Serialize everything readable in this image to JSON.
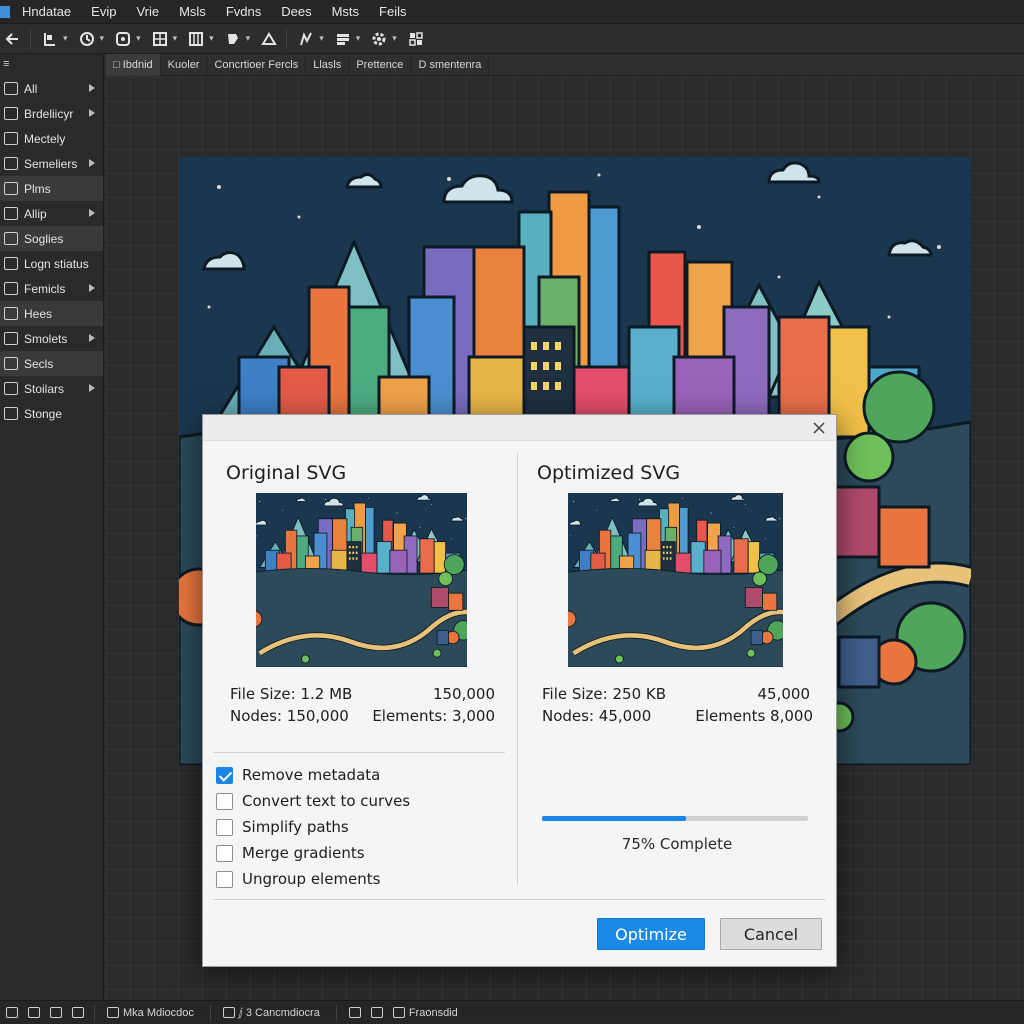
{
  "app": {
    "menu": [
      "Hndatae",
      "Evip",
      "Vrie",
      "Msls",
      "Fvdns",
      "Dees",
      "Msts",
      "Feils"
    ]
  },
  "toolbar": {
    "icons": [
      "back-icon",
      "select-tool-icon",
      "rotate-icon",
      "node-tool-icon",
      "grid-icon",
      "columns-icon",
      "bucket-icon",
      "crop-icon",
      "pen-icon",
      "layers-icon",
      "settings-icon",
      "component-icon"
    ]
  },
  "left_panel": {
    "header": "≡",
    "items": [
      {
        "label": "All",
        "icon": "grid-icon",
        "has_arrow": true,
        "highlight": false
      },
      {
        "label": "Brdeliicyr",
        "icon": "layers-icon",
        "has_arrow": true,
        "highlight": false
      },
      {
        "label": "Mectely",
        "icon": "image-icon",
        "has_arrow": false,
        "highlight": false
      },
      {
        "label": "Semeliers",
        "icon": "shapes-icon",
        "has_arrow": true,
        "highlight": false
      },
      {
        "label": "Plms",
        "icon": "brush-icon",
        "has_arrow": false,
        "highlight": true
      },
      {
        "label": "Allip",
        "icon": "clip-icon",
        "has_arrow": true,
        "highlight": false
      },
      {
        "label": "Soglies",
        "icon": "link-icon",
        "has_arrow": false,
        "highlight": true
      },
      {
        "label": "Logn stiatus",
        "icon": "login-icon",
        "has_arrow": false,
        "highlight": false
      },
      {
        "label": "Femicls",
        "icon": "folder-icon",
        "has_arrow": true,
        "highlight": false
      },
      {
        "label": "Hees",
        "icon": "grid-icon",
        "has_arrow": false,
        "highlight": true
      },
      {
        "label": "Smolets",
        "icon": "diamond-icon",
        "has_arrow": true,
        "highlight": false
      },
      {
        "label": "Secls",
        "icon": "palette-icon",
        "has_arrow": false,
        "highlight": true
      },
      {
        "label": "Stoilars",
        "icon": "sliders-icon",
        "has_arrow": true,
        "highlight": false
      },
      {
        "label": "Stonge",
        "icon": "storage-icon",
        "has_arrow": false,
        "highlight": false
      }
    ]
  },
  "doc_tabs": [
    "□ Ibdnid",
    "Kuoler",
    "Concrtioer Fercls",
    "Llasls",
    "Prettence",
    "D smentenra"
  ],
  "status_bar": {
    "items": [
      "Mka Mdiocdoc",
      "ⅉ 3 Cancmdiocra",
      "Fraonsdid"
    ]
  },
  "dialog": {
    "left": {
      "title": "Original SVG",
      "file_size": "File Size: 1.2 MB",
      "count": "150,000",
      "nodes": "Nodes: 150,000",
      "elements": "Elements: 3,000"
    },
    "right": {
      "title": "Optimized SVG",
      "file_size": "File Size: 250 KB",
      "count": "45,000",
      "nodes": "Nodes: 45,000",
      "elements": "Elements 8,000"
    },
    "options": [
      {
        "label": "Remove metadata",
        "checked": true
      },
      {
        "label": "Convert text to curves",
        "checked": false
      },
      {
        "label": "Simplify paths",
        "checked": false
      },
      {
        "label": "Merge gradients",
        "checked": false
      },
      {
        "label": "Ungroup elements",
        "checked": false
      }
    ],
    "progress": {
      "fraction": 0.54,
      "label": "75% Complete"
    },
    "buttons": {
      "primary": "Optimize",
      "secondary": "Cancel"
    }
  },
  "colors": {
    "accent": "#1b84e7",
    "artboard_sky": "#1b3750",
    "ui_dark": "#2b2b2b"
  }
}
